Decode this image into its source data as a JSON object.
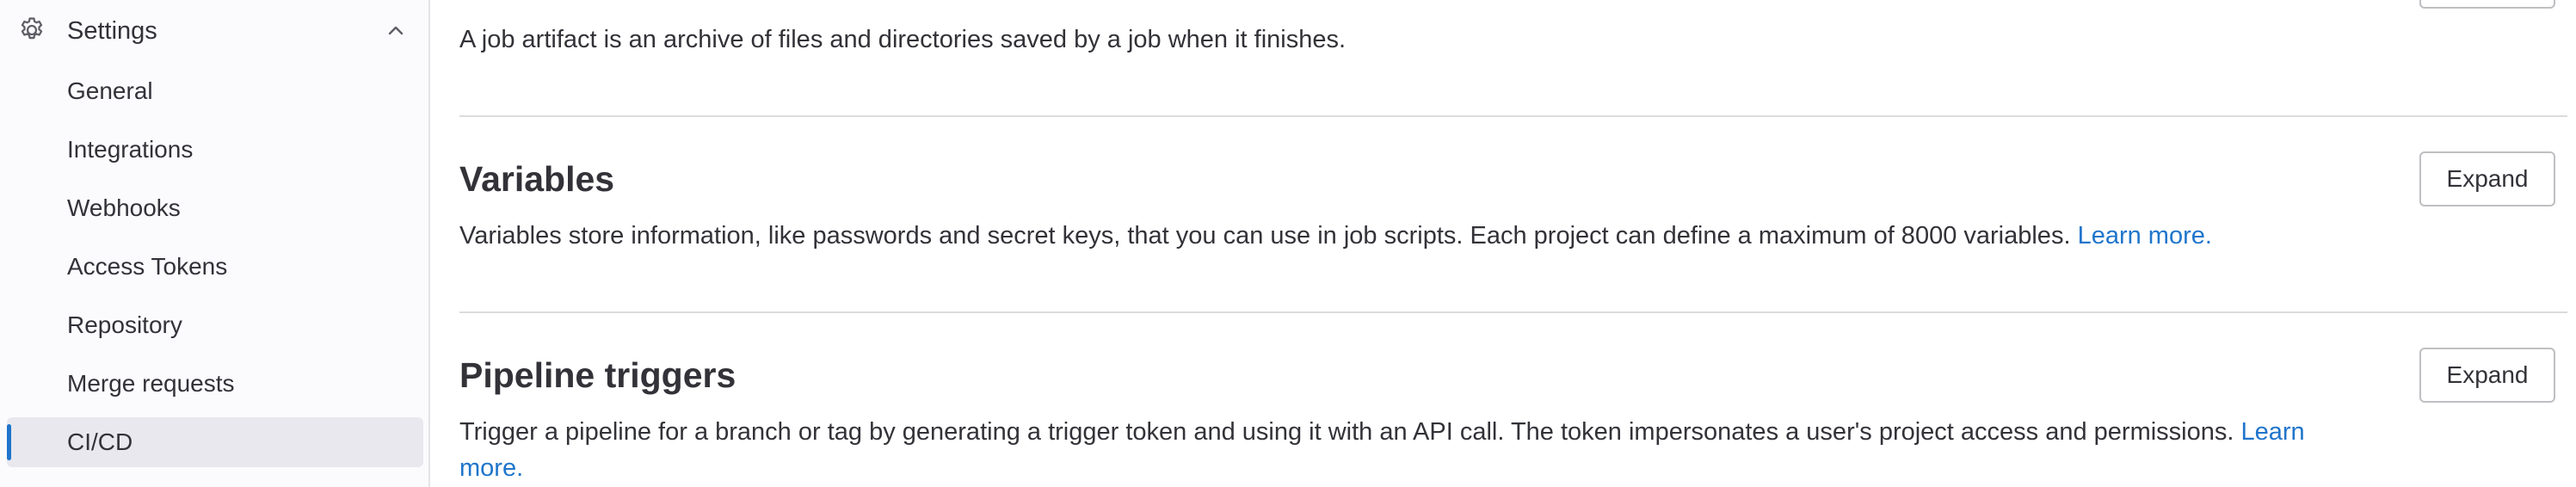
{
  "sidebar": {
    "section_label": "Settings",
    "items": [
      {
        "label": "General"
      },
      {
        "label": "Integrations"
      },
      {
        "label": "Webhooks"
      },
      {
        "label": "Access Tokens"
      },
      {
        "label": "Repository"
      },
      {
        "label": "Merge requests"
      },
      {
        "label": "CI/CD",
        "active": true
      }
    ]
  },
  "sections": {
    "artifacts": {
      "description": "A job artifact is an archive of files and directories saved by a job when it finishes."
    },
    "variables": {
      "title": "Variables",
      "expand_label": "Expand",
      "description": "Variables store information, like passwords and secret keys, that you can use in job scripts. Each project can define a maximum of 8000 variables.",
      "learn_more": "Learn more."
    },
    "pipeline_triggers": {
      "title": "Pipeline triggers",
      "expand_label": "Expand",
      "description": "Trigger a pipeline for a branch or tag by generating a trigger token and using it with an API call. The token impersonates a user's project access and permissions.",
      "learn_more_1": "Learn",
      "learn_more_2": "more."
    }
  },
  "colors": {
    "accent": "#1f75cb",
    "active_bg": "#e9e8ee",
    "text": "#333238",
    "divider": "#dcdcde"
  }
}
